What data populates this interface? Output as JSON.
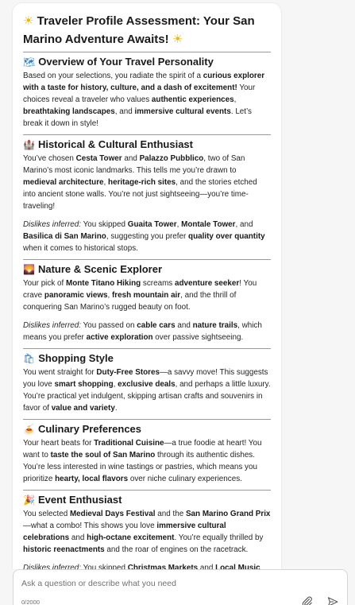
{
  "title": "Traveler Profile Assessment: Your San Marino Adventure Awaits!",
  "title_emoji": "☀",
  "sections": [
    {
      "icon": "map-icon",
      "emoji": "🗺",
      "heading": "Overview of Your Travel Personality",
      "paragraphs": [
        [
          {
            "t": "Based on your selections, you radiate the spirit of a "
          },
          {
            "t": "curious explorer with a taste for history, culture, and a dash of excitement!",
            "b": true
          },
          {
            "t": " Your choices reveal a traveler who values "
          },
          {
            "t": "authentic experiences",
            "b": true
          },
          {
            "t": ", "
          },
          {
            "t": "breathtaking landscapes",
            "b": true
          },
          {
            "t": ", and "
          },
          {
            "t": "immersive cultural events",
            "b": true
          },
          {
            "t": ". Let’s break it down in style!"
          }
        ]
      ]
    },
    {
      "icon": "castle-icon",
      "emoji": "🏰",
      "heading": "Historical & Cultural Enthusiast",
      "paragraphs": [
        [
          {
            "t": "You’ve chosen "
          },
          {
            "t": "Cesta Tower",
            "b": true
          },
          {
            "t": " and "
          },
          {
            "t": "Palazzo Pubblico",
            "b": true
          },
          {
            "t": ", two of San Marino’s most iconic landmarks. This tells me you’re drawn to "
          },
          {
            "t": "medieval architecture",
            "b": true
          },
          {
            "t": ", "
          },
          {
            "t": "heritage-rich sites",
            "b": true
          },
          {
            "t": ", and the stories etched into ancient stone walls. You’re not just sightseeing—you’re time-traveling!"
          }
        ],
        [
          {
            "t": "Dislikes inferred:",
            "i": true
          },
          {
            "t": " You skipped "
          },
          {
            "t": "Guaita Tower",
            "b": true
          },
          {
            "t": ", "
          },
          {
            "t": "Montale Tower",
            "b": true
          },
          {
            "t": ", and "
          },
          {
            "t": "Basilica di San Marino",
            "b": true
          },
          {
            "t": ", suggesting you prefer "
          },
          {
            "t": "quality over quantity",
            "b": true
          },
          {
            "t": " when it comes to historical stops."
          }
        ]
      ]
    },
    {
      "icon": "mountain-sunrise-icon",
      "emoji": "🌄",
      "heading": "Nature & Scenic Explorer",
      "paragraphs": [
        [
          {
            "t": "Your pick of "
          },
          {
            "t": "Monte Titano Hiking",
            "b": true
          },
          {
            "t": " screams "
          },
          {
            "t": "adventure seeker",
            "b": true
          },
          {
            "t": "! You crave "
          },
          {
            "t": "panoramic views",
            "b": true
          },
          {
            "t": ", "
          },
          {
            "t": "fresh mountain air",
            "b": true
          },
          {
            "t": ", and the thrill of conquering San Marino’s rugged beauty on foot."
          }
        ],
        [
          {
            "t": "Dislikes inferred:",
            "i": true
          },
          {
            "t": " You passed on "
          },
          {
            "t": "cable cars",
            "b": true
          },
          {
            "t": " and "
          },
          {
            "t": "nature trails",
            "b": true
          },
          {
            "t": ", which means you prefer "
          },
          {
            "t": "active exploration",
            "b": true
          },
          {
            "t": " over passive sightseeing."
          }
        ]
      ]
    },
    {
      "icon": "shopping-bags-icon",
      "emoji": "🛍",
      "heading": "Shopping Style",
      "paragraphs": [
        [
          {
            "t": "You went straight for "
          },
          {
            "t": "Duty-Free Stores",
            "b": true
          },
          {
            "t": "—a savvy move! This suggests you love "
          },
          {
            "t": "smart shopping",
            "b": true
          },
          {
            "t": ", "
          },
          {
            "t": "exclusive deals",
            "b": true
          },
          {
            "t": ", and perhaps a little luxury. You’re practical yet indulgent, skipping artisan crafts and souvenirs in favor of "
          },
          {
            "t": "value and variety",
            "b": true
          },
          {
            "t": "."
          }
        ]
      ]
    },
    {
      "icon": "food-plate-icon",
      "emoji": "🍝",
      "heading": "Culinary Preferences",
      "paragraphs": [
        [
          {
            "t": "Your heart beats for "
          },
          {
            "t": "Traditional Cuisine",
            "b": true
          },
          {
            "t": "—a true foodie at heart! You want to "
          },
          {
            "t": "taste the soul of San Marino",
            "b": true
          },
          {
            "t": " through its authentic dishes. You’re less interested in wine tastings or pastries, which means you prioritize "
          },
          {
            "t": "hearty, local flavors",
            "b": true
          },
          {
            "t": " over niche culinary experiences."
          }
        ]
      ]
    },
    {
      "icon": "party-popper-icon",
      "emoji": "🎉",
      "heading": "Event Enthusiast",
      "paragraphs": [
        [
          {
            "t": "You selected "
          },
          {
            "t": "Medieval Days Festival",
            "b": true
          },
          {
            "t": " and the "
          },
          {
            "t": "San Marino Grand Prix",
            "b": true
          },
          {
            "t": "—what a combo! This shows you love "
          },
          {
            "t": "immersive cultural celebrations",
            "b": true
          },
          {
            "t": " and "
          },
          {
            "t": "high-octane excitement",
            "b": true
          },
          {
            "t": ". You’re equally thrilled by "
          },
          {
            "t": "historic reenactments",
            "b": true
          },
          {
            "t": " and the roar of engines on the racetrack."
          }
        ],
        [
          {
            "t": "Dislikes inferred:",
            "i": true
          },
          {
            "t": " You skipped "
          },
          {
            "t": "Christmas Markets",
            "b": true
          },
          {
            "t": " and "
          },
          {
            "t": "Local Music",
            "b": true
          }
        ]
      ]
    }
  ],
  "composer": {
    "placeholder": "Ask a question or describe what you need",
    "value": "",
    "counter": "0/2000"
  }
}
